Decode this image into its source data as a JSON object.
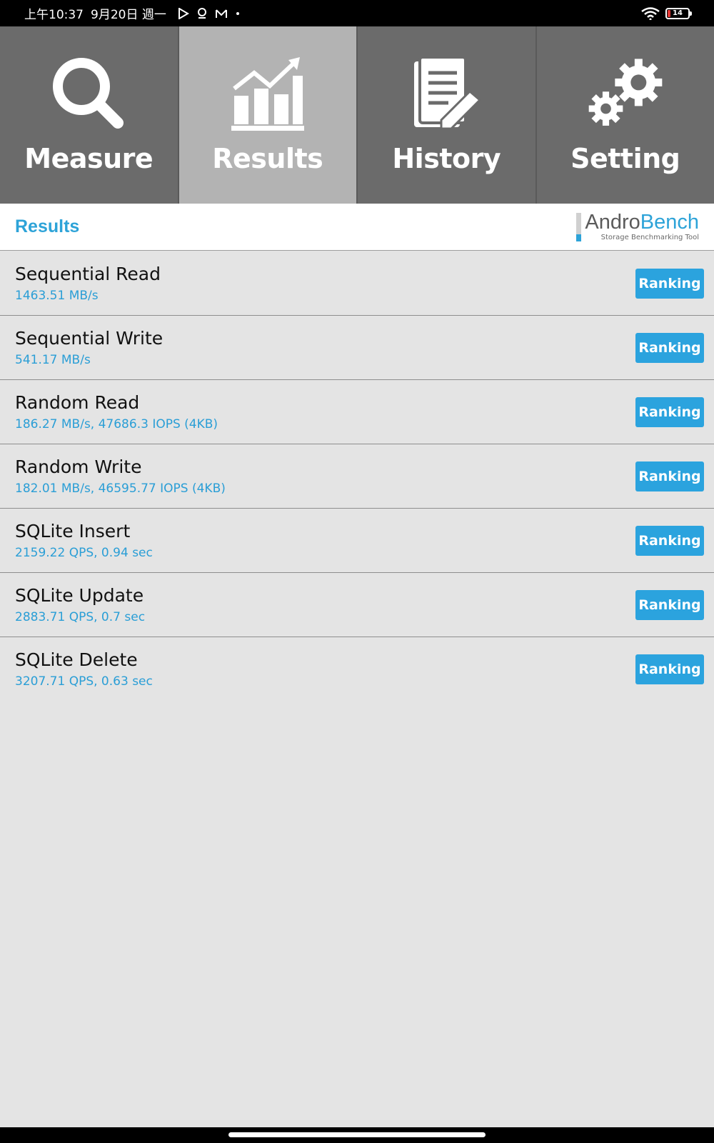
{
  "status_bar": {
    "time": "上午10:37",
    "date": "9月20日 週一",
    "battery": "14",
    "icons": [
      "play-icon",
      "location-icon",
      "mail-icon",
      "dot-icon",
      "wifi-icon",
      "battery-icon"
    ]
  },
  "tabs": [
    {
      "label": "Measure",
      "icon": "search-icon",
      "active": false
    },
    {
      "label": "Results",
      "icon": "chart-icon",
      "active": true
    },
    {
      "label": "History",
      "icon": "document-icon",
      "active": false
    },
    {
      "label": "Setting",
      "icon": "gear-icon",
      "active": false
    }
  ],
  "header": {
    "title": "Results",
    "brand_andro": "Andro",
    "brand_bench": "Bench",
    "brand_sub": "Storage Benchmarking Tool"
  },
  "results": [
    {
      "name": "Sequential Read",
      "value": "1463.51 MB/s",
      "button": "Ranking"
    },
    {
      "name": "Sequential Write",
      "value": "541.17 MB/s",
      "button": "Ranking"
    },
    {
      "name": "Random Read",
      "value": "186.27 MB/s, 47686.3 IOPS (4KB)",
      "button": "Ranking"
    },
    {
      "name": "Random Write",
      "value": "182.01 MB/s, 46595.77 IOPS (4KB)",
      "button": "Ranking"
    },
    {
      "name": "SQLite Insert",
      "value": "2159.22 QPS, 0.94 sec",
      "button": "Ranking"
    },
    {
      "name": "SQLite Update",
      "value": "2883.71 QPS, 0.7 sec",
      "button": "Ranking"
    },
    {
      "name": "SQLite Delete",
      "value": "3207.71 QPS, 0.63 sec",
      "button": "Ranking"
    }
  ],
  "colors": {
    "accent": "#2da3d8",
    "tab_bg": "#6b6b6b",
    "tab_active_bg": "#b3b3b3",
    "list_bg": "#e4e4e4"
  }
}
